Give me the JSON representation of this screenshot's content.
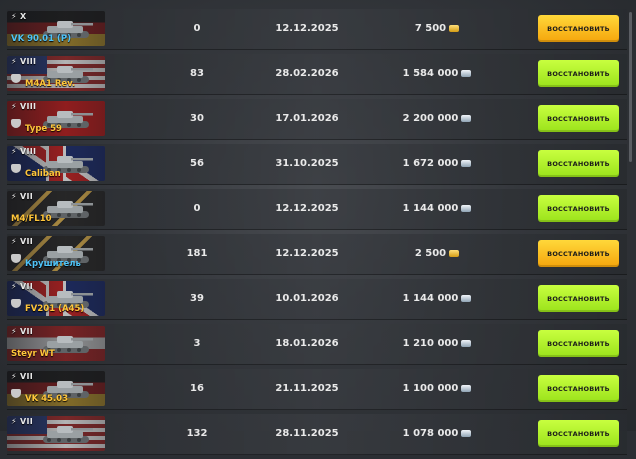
{
  "button_label": "ВОССТАНОВИТЬ",
  "colors": {
    "button_green": "#a8ea25",
    "button_gold": "#f8b81c",
    "name_gold": "#ffc63a",
    "name_blue": "#4fc3f7"
  },
  "rows": [
    {
      "tier": "X",
      "tank_name": "VK 90.01 (P)",
      "name_color": "blue",
      "count": "0",
      "date": "12.12.2025",
      "price": "7 500",
      "currency_icon": "gold-icon",
      "button_style": "gold",
      "flag": "de",
      "has_badge": false
    },
    {
      "tier": "VIII",
      "tank_name": "M4A1 Rev.",
      "name_color": "gold",
      "count": "83",
      "date": "28.02.2026",
      "price": "1 584 000",
      "currency_icon": "silver-icon",
      "button_style": "green",
      "flag": "us",
      "has_badge": true
    },
    {
      "tier": "VIII",
      "tank_name": "Type 59",
      "name_color": "gold",
      "count": "30",
      "date": "17.01.2026",
      "price": "2 200 000",
      "currency_icon": "silver-icon",
      "button_style": "green",
      "flag": "cn",
      "has_badge": true
    },
    {
      "tier": "VIII",
      "tank_name": "Caliban",
      "name_color": "gold",
      "count": "56",
      "date": "31.10.2025",
      "price": "1 672 000",
      "currency_icon": "silver-icon",
      "button_style": "green",
      "flag": "uk",
      "has_badge": true
    },
    {
      "tier": "VII",
      "tank_name": "M4/FL10",
      "name_color": "gold",
      "count": "0",
      "date": "12.12.2025",
      "price": "1 144 000",
      "currency_icon": "silver-icon",
      "button_style": "green",
      "flag": "gold",
      "has_badge": false
    },
    {
      "tier": "VII",
      "tank_name": "Крушитель",
      "name_color": "blue",
      "count": "181",
      "date": "12.12.2025",
      "price": "2 500",
      "currency_icon": "gold-icon",
      "button_style": "gold",
      "flag": "gold",
      "has_badge": true
    },
    {
      "tier": "VII",
      "tank_name": "FV201 (A45)",
      "name_color": "gold",
      "count": "39",
      "date": "10.01.2026",
      "price": "1 144 000",
      "currency_icon": "silver-icon",
      "button_style": "green",
      "flag": "uk",
      "has_badge": true
    },
    {
      "tier": "VII",
      "tank_name": "Steyr WT",
      "name_color": "gold",
      "count": "3",
      "date": "18.01.2026",
      "price": "1 210 000",
      "currency_icon": "silver-icon",
      "button_style": "green",
      "flag": "at",
      "has_badge": false
    },
    {
      "tier": "VII",
      "tank_name": "VK 45.03",
      "name_color": "gold",
      "count": "16",
      "date": "21.11.2025",
      "price": "1 100 000",
      "currency_icon": "silver-icon",
      "button_style": "green",
      "flag": "de",
      "has_badge": true
    },
    {
      "tier": "VII",
      "tank_name": "",
      "name_color": "gold",
      "count": "132",
      "date": "28.11.2025",
      "price": "1 078 000",
      "currency_icon": "silver-icon",
      "button_style": "green",
      "flag": "us",
      "has_badge": false
    }
  ]
}
